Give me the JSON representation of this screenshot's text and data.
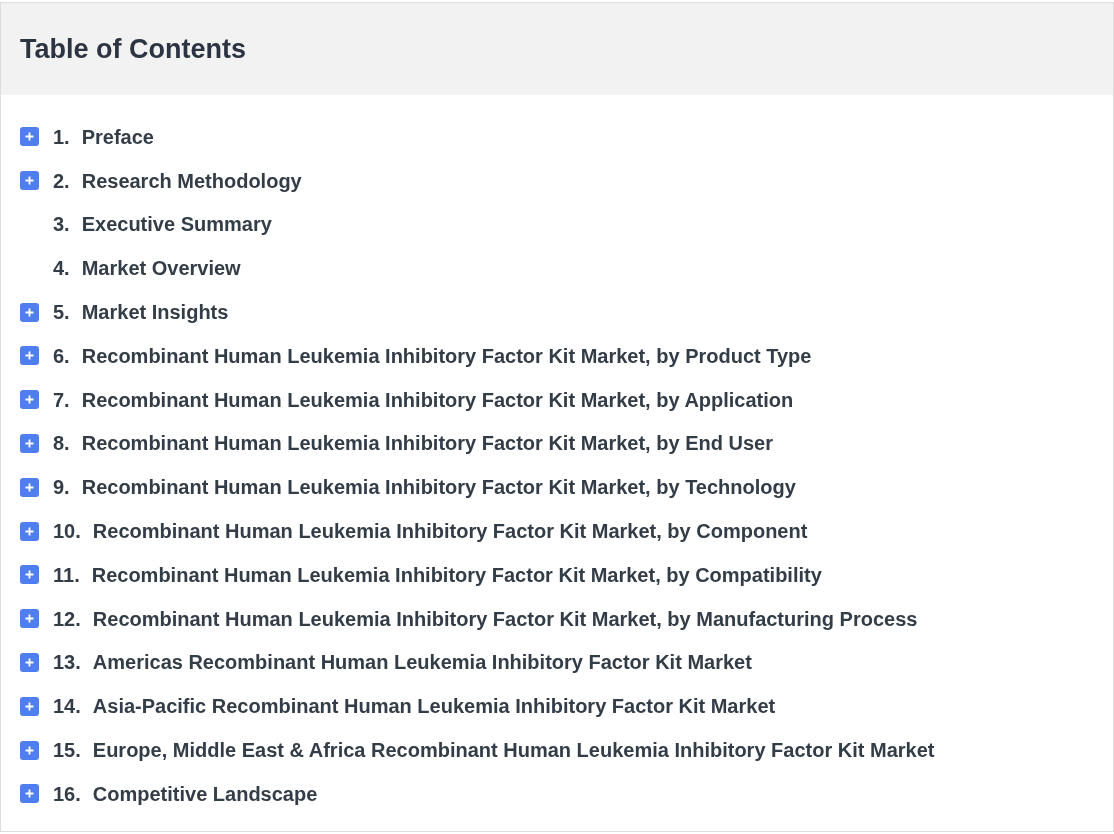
{
  "header": {
    "title": "Table of Contents"
  },
  "items": [
    {
      "number": "1.",
      "title": "Preface",
      "expandable": true
    },
    {
      "number": "2.",
      "title": "Research Methodology",
      "expandable": true
    },
    {
      "number": "3.",
      "title": "Executive Summary",
      "expandable": false
    },
    {
      "number": "4.",
      "title": "Market Overview",
      "expandable": false
    },
    {
      "number": "5.",
      "title": "Market Insights",
      "expandable": true
    },
    {
      "number": "6.",
      "title": "Recombinant Human Leukemia Inhibitory Factor Kit Market, by Product Type",
      "expandable": true
    },
    {
      "number": "7.",
      "title": "Recombinant Human Leukemia Inhibitory Factor Kit Market, by Application",
      "expandable": true
    },
    {
      "number": "8.",
      "title": "Recombinant Human Leukemia Inhibitory Factor Kit Market, by End User",
      "expandable": true
    },
    {
      "number": "9.",
      "title": "Recombinant Human Leukemia Inhibitory Factor Kit Market, by Technology",
      "expandable": true
    },
    {
      "number": "10.",
      "title": "Recombinant Human Leukemia Inhibitory Factor Kit Market, by Component",
      "expandable": true
    },
    {
      "number": "11.",
      "title": "Recombinant Human Leukemia Inhibitory Factor Kit Market, by Compatibility",
      "expandable": true
    },
    {
      "number": "12.",
      "title": "Recombinant Human Leukemia Inhibitory Factor Kit Market, by Manufacturing Process",
      "expandable": true
    },
    {
      "number": "13.",
      "title": "Americas Recombinant Human Leukemia Inhibitory Factor Kit Market",
      "expandable": true
    },
    {
      "number": "14.",
      "title": "Asia-Pacific Recombinant Human Leukemia Inhibitory Factor Kit Market",
      "expandable": true
    },
    {
      "number": "15.",
      "title": "Europe, Middle East & Africa Recombinant Human Leukemia Inhibitory Factor Kit Market",
      "expandable": true
    },
    {
      "number": "16.",
      "title": "Competitive Landscape",
      "expandable": true
    }
  ]
}
